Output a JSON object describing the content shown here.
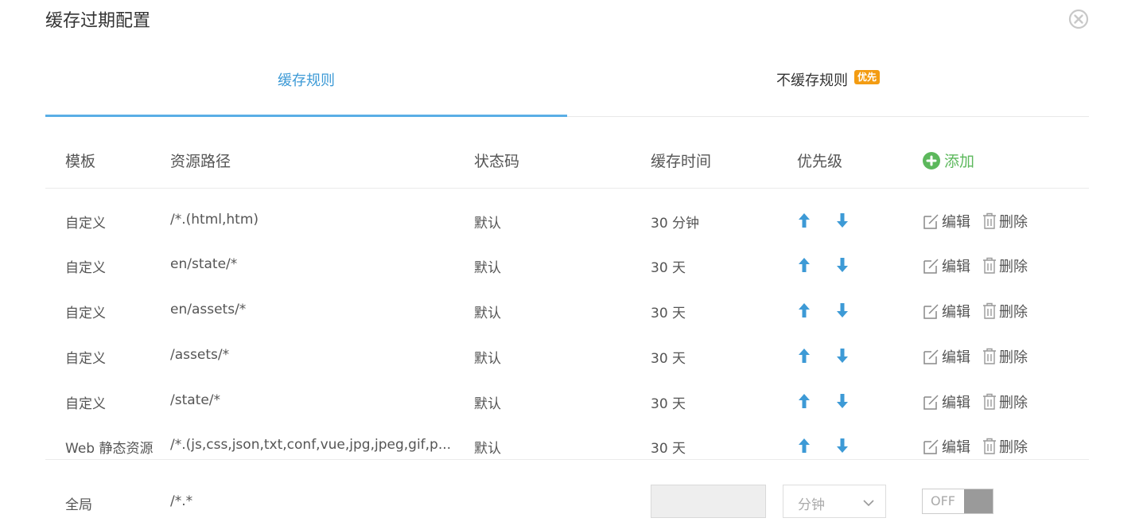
{
  "dialog": {
    "title": "缓存过期配置",
    "close_icon": "close-circle-icon"
  },
  "tabs": [
    {
      "label": "缓存规则",
      "active": true
    },
    {
      "label": "不缓存规则",
      "badge": "优先",
      "active": false
    }
  ],
  "table": {
    "headers": {
      "template": "模板",
      "path": "资源路径",
      "status": "状态码",
      "cache_time": "缓存时间",
      "priority": "优先级",
      "add": "添加"
    },
    "rows": [
      {
        "template": "自定义",
        "path": "/*.(html,htm)",
        "status": "默认",
        "cache_time": "30 分钟",
        "edit": "编辑",
        "delete": "删除"
      },
      {
        "template": "自定义",
        "path": "en/state/*",
        "status": "默认",
        "cache_time": "30 天",
        "edit": "编辑",
        "delete": "删除"
      },
      {
        "template": "自定义",
        "path": "en/assets/*",
        "status": "默认",
        "cache_time": "30 天",
        "edit": "编辑",
        "delete": "删除"
      },
      {
        "template": "自定义",
        "path": "/assets/*",
        "status": "默认",
        "cache_time": "30 天",
        "edit": "编辑",
        "delete": "删除"
      },
      {
        "template": "自定义",
        "path": "/state/*",
        "status": "默认",
        "cache_time": "30 天",
        "edit": "编辑",
        "delete": "删除"
      },
      {
        "template": "Web 静态资源",
        "path": "/*.(js,css,json,txt,conf,vue,jpg,jpeg,gif,p...",
        "status": "默认",
        "cache_time": "30 天",
        "edit": "编辑",
        "delete": "删除"
      }
    ]
  },
  "global": {
    "label": "全局",
    "path": "/*.*",
    "time_value": "",
    "unit_selected": "分钟",
    "toggle_label": "OFF"
  },
  "colors": {
    "accent": "#3d9ad6",
    "add_green": "#5cb85c",
    "badge": "#f39c12",
    "arrow_blue": "#3d9ad6"
  }
}
